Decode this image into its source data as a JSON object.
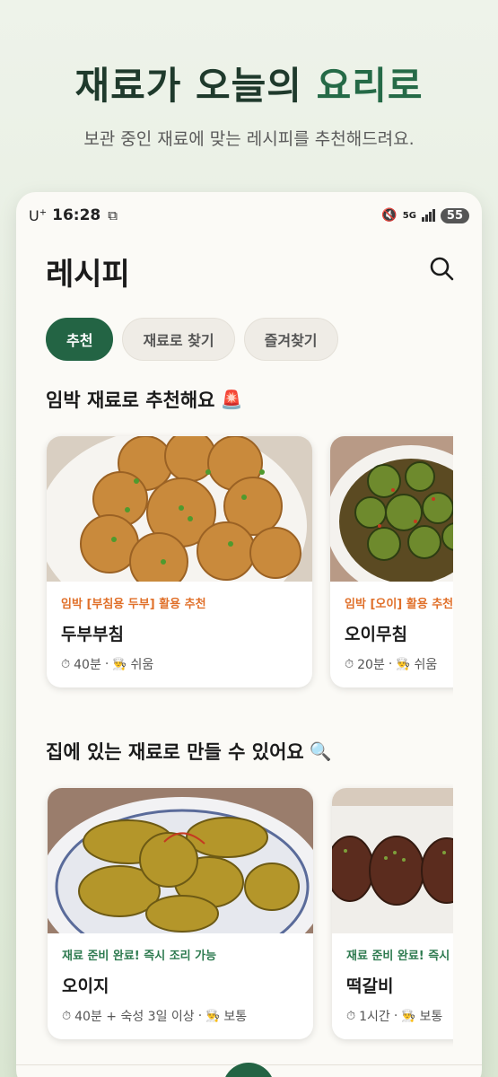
{
  "hero": {
    "title_main": "재료가 오늘의 ",
    "title_accent": "요리로",
    "subtitle": "보관 중인 재료에 맞는 레시피를 추천해드려요."
  },
  "status_bar": {
    "carrier": "U",
    "carrier_sup": "+",
    "time": "16:28",
    "network": "5G",
    "battery": "55"
  },
  "app": {
    "title": "레시피"
  },
  "tabs": [
    {
      "label": "추천",
      "active": true
    },
    {
      "label": "재료로 찾기",
      "active": false
    },
    {
      "label": "즐겨찾기",
      "active": false
    }
  ],
  "sections": {
    "expiring": {
      "title": "임박 재료로 추천해요",
      "icon": "siren-emoji",
      "cards": [
        {
          "tag": "임박 [부침용 두부] 활용 추천",
          "name": "두부부침",
          "time": "40분",
          "difficulty": "쉬움"
        },
        {
          "tag": "임박 [오이] 활용 추천",
          "name": "오이무침",
          "time": "20분",
          "difficulty": "쉬움"
        }
      ]
    },
    "at_home": {
      "title": "집에 있는 재료로 만들 수 있어요",
      "icon": "magnifier-emoji",
      "cards": [
        {
          "tag": "재료 준비 완료! 즉시 조리 가능",
          "name": "오이지",
          "time": "40분 + 숙성 3일 이상",
          "difficulty": "보통"
        },
        {
          "tag": "재료 준비 완료! 즉시 조리 가능",
          "name": "떡갈비",
          "time": "1시간",
          "difficulty": "보통"
        }
      ]
    }
  },
  "colors": {
    "brand_green": "#236444",
    "accent_orange": "#e0702a",
    "title_dark": "#1f3a2c"
  }
}
